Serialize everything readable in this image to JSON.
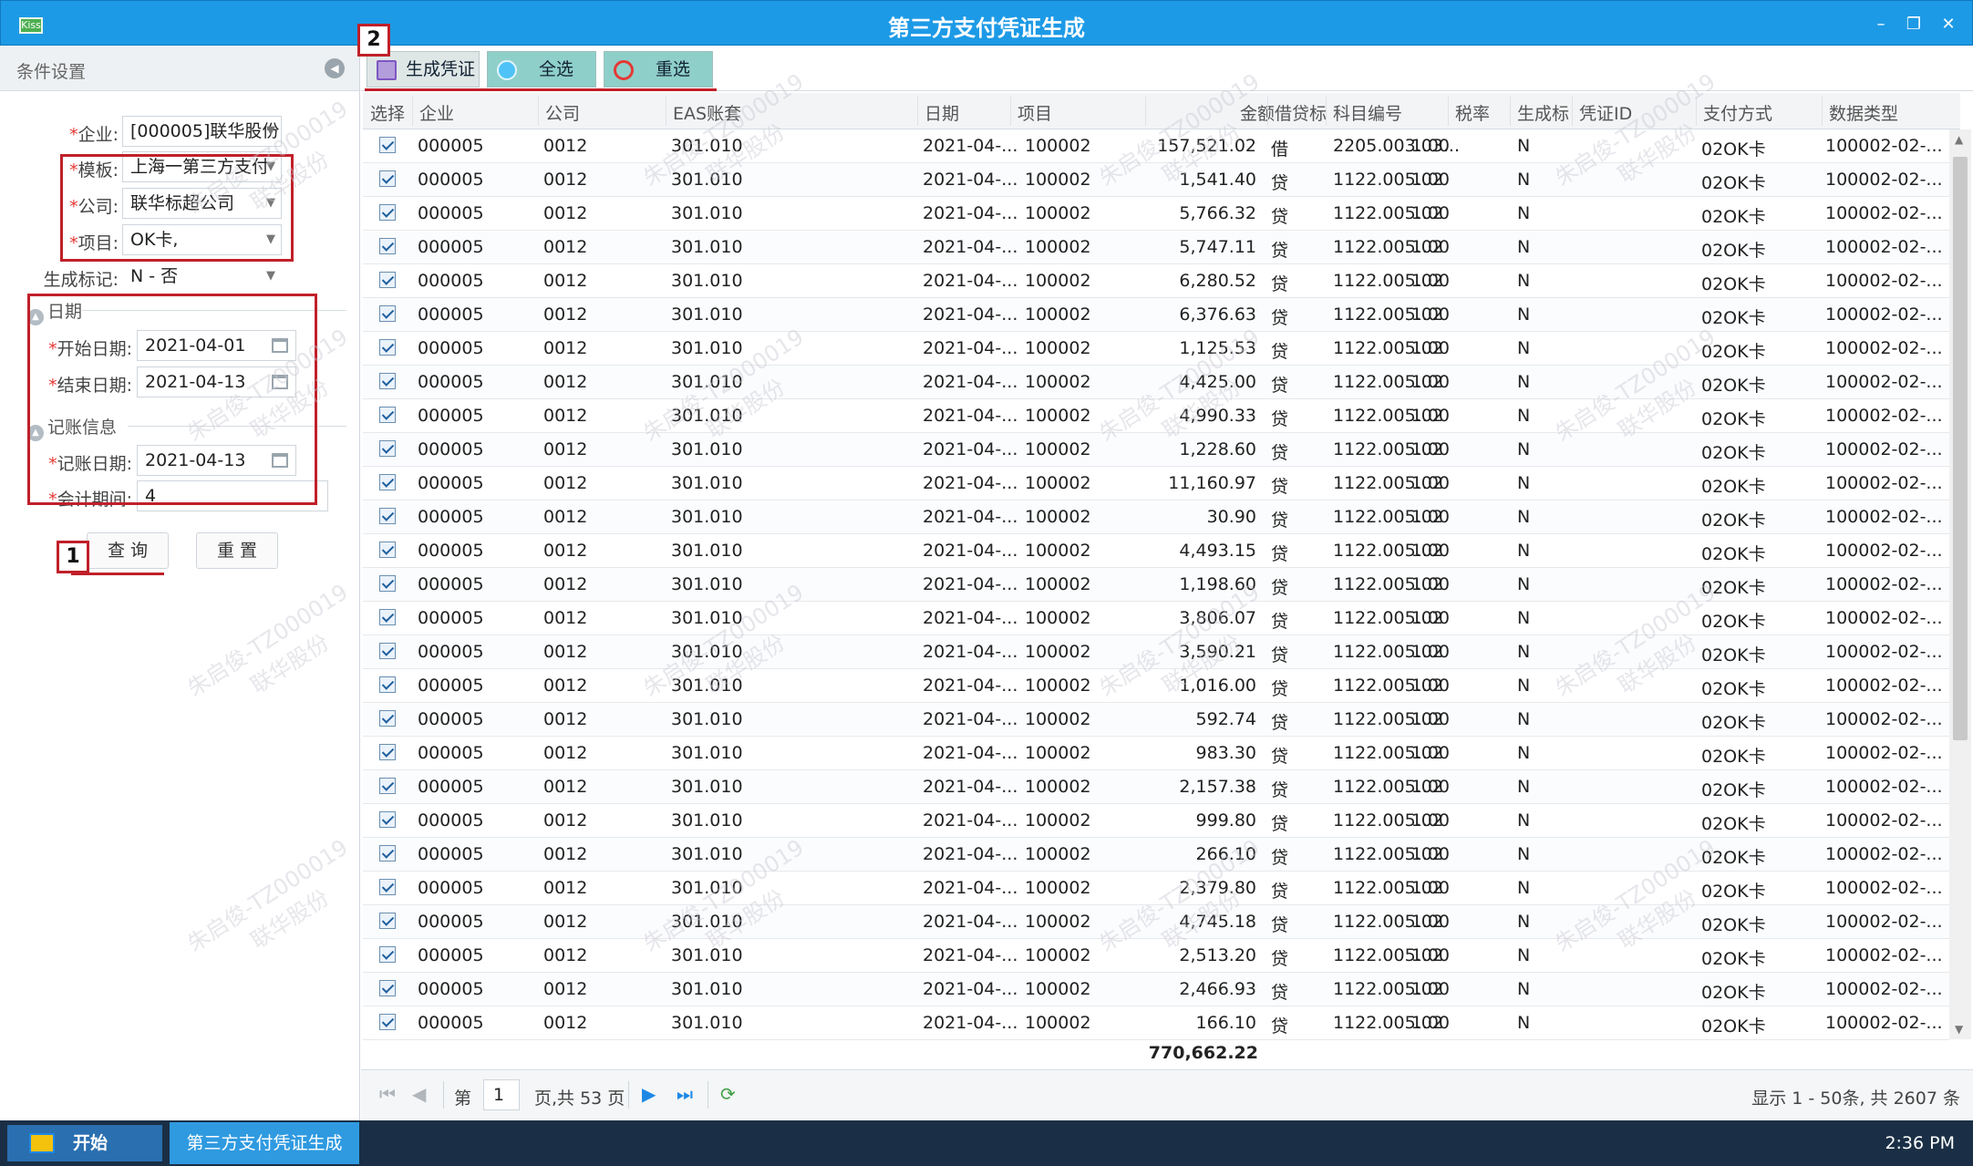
{
  "window": {
    "title": "第三方支付凭证生成",
    "app_icon_text": "Kiss",
    "minimize": "–",
    "restore": "❐",
    "close": "✕"
  },
  "left_panel": {
    "header": "条件设置",
    "fields": {
      "enterprise": {
        "label": "企业:",
        "value": "[000005]联华股份"
      },
      "template": {
        "label": "模板:",
        "value": "上海一第三方支付"
      },
      "company": {
        "label": "公司:",
        "value": "联华标超公司"
      },
      "project": {
        "label": "项目:",
        "value": "OK卡,"
      },
      "gen_flag": {
        "label": "生成标记:",
        "value": "N - 否"
      },
      "start_date": {
        "label": "开始日期:",
        "value": "2021-04-01"
      },
      "end_date": {
        "label": "结束日期:",
        "value": "2021-04-13"
      },
      "post_date": {
        "label": "记账日期:",
        "value": "2021-04-13"
      },
      "period": {
        "label": "会计期间:",
        "value": "4"
      }
    },
    "sections": {
      "date": "日期",
      "posting": "记账信息"
    },
    "query_button": "查 询",
    "reset_button": "重 置",
    "marker_1": "1"
  },
  "toolbar": {
    "generate": "生成凭证",
    "select_all": "全选",
    "reselect": "重选",
    "marker_2": "2"
  },
  "grid": {
    "columns": [
      "选择",
      "企业",
      "公司",
      "EAS账套",
      "日期",
      "项目",
      "金额",
      "借贷标",
      "科目编号",
      "税率",
      "生成标",
      "凭证ID",
      "支付方式",
      "数据类型"
    ],
    "rows": [
      {
        "ent": "000005",
        "co": "0012",
        "eas": "301.010",
        "date": "2021-04-...",
        "proj": "100002",
        "amt": "157,521.02",
        "dc": "借",
        "acct": "2205.003.03...",
        "tax": "1.00",
        "gen": "N",
        "vid": "",
        "pay": "02OK卡",
        "type": "100002-02-..."
      },
      {
        "ent": "000005",
        "co": "0012",
        "eas": "301.010",
        "date": "2021-04-...",
        "proj": "100002",
        "amt": "1,541.40",
        "dc": "贷",
        "acct": "1122.005.02",
        "tax": "1.00",
        "gen": "N",
        "vid": "",
        "pay": "02OK卡",
        "type": "100002-02-..."
      },
      {
        "ent": "000005",
        "co": "0012",
        "eas": "301.010",
        "date": "2021-04-...",
        "proj": "100002",
        "amt": "5,766.32",
        "dc": "贷",
        "acct": "1122.005.02",
        "tax": "1.00",
        "gen": "N",
        "vid": "",
        "pay": "02OK卡",
        "type": "100002-02-..."
      },
      {
        "ent": "000005",
        "co": "0012",
        "eas": "301.010",
        "date": "2021-04-...",
        "proj": "100002",
        "amt": "5,747.11",
        "dc": "贷",
        "acct": "1122.005.02",
        "tax": "1.00",
        "gen": "N",
        "vid": "",
        "pay": "02OK卡",
        "type": "100002-02-..."
      },
      {
        "ent": "000005",
        "co": "0012",
        "eas": "301.010",
        "date": "2021-04-...",
        "proj": "100002",
        "amt": "6,280.52",
        "dc": "贷",
        "acct": "1122.005.02",
        "tax": "1.00",
        "gen": "N",
        "vid": "",
        "pay": "02OK卡",
        "type": "100002-02-..."
      },
      {
        "ent": "000005",
        "co": "0012",
        "eas": "301.010",
        "date": "2021-04-...",
        "proj": "100002",
        "amt": "6,376.63",
        "dc": "贷",
        "acct": "1122.005.02",
        "tax": "1.00",
        "gen": "N",
        "vid": "",
        "pay": "02OK卡",
        "type": "100002-02-..."
      },
      {
        "ent": "000005",
        "co": "0012",
        "eas": "301.010",
        "date": "2021-04-...",
        "proj": "100002",
        "amt": "1,125.53",
        "dc": "贷",
        "acct": "1122.005.02",
        "tax": "1.00",
        "gen": "N",
        "vid": "",
        "pay": "02OK卡",
        "type": "100002-02-..."
      },
      {
        "ent": "000005",
        "co": "0012",
        "eas": "301.010",
        "date": "2021-04-...",
        "proj": "100002",
        "amt": "4,425.00",
        "dc": "贷",
        "acct": "1122.005.02",
        "tax": "1.00",
        "gen": "N",
        "vid": "",
        "pay": "02OK卡",
        "type": "100002-02-..."
      },
      {
        "ent": "000005",
        "co": "0012",
        "eas": "301.010",
        "date": "2021-04-...",
        "proj": "100002",
        "amt": "4,990.33",
        "dc": "贷",
        "acct": "1122.005.02",
        "tax": "1.00",
        "gen": "N",
        "vid": "",
        "pay": "02OK卡",
        "type": "100002-02-..."
      },
      {
        "ent": "000005",
        "co": "0012",
        "eas": "301.010",
        "date": "2021-04-...",
        "proj": "100002",
        "amt": "1,228.60",
        "dc": "贷",
        "acct": "1122.005.02",
        "tax": "1.00",
        "gen": "N",
        "vid": "",
        "pay": "02OK卡",
        "type": "100002-02-..."
      },
      {
        "ent": "000005",
        "co": "0012",
        "eas": "301.010",
        "date": "2021-04-...",
        "proj": "100002",
        "amt": "11,160.97",
        "dc": "贷",
        "acct": "1122.005.02",
        "tax": "1.00",
        "gen": "N",
        "vid": "",
        "pay": "02OK卡",
        "type": "100002-02-..."
      },
      {
        "ent": "000005",
        "co": "0012",
        "eas": "301.010",
        "date": "2021-04-...",
        "proj": "100002",
        "amt": "30.90",
        "dc": "贷",
        "acct": "1122.005.02",
        "tax": "1.00",
        "gen": "N",
        "vid": "",
        "pay": "02OK卡",
        "type": "100002-02-..."
      },
      {
        "ent": "000005",
        "co": "0012",
        "eas": "301.010",
        "date": "2021-04-...",
        "proj": "100002",
        "amt": "4,493.15",
        "dc": "贷",
        "acct": "1122.005.02",
        "tax": "1.00",
        "gen": "N",
        "vid": "",
        "pay": "02OK卡",
        "type": "100002-02-..."
      },
      {
        "ent": "000005",
        "co": "0012",
        "eas": "301.010",
        "date": "2021-04-...",
        "proj": "100002",
        "amt": "1,198.60",
        "dc": "贷",
        "acct": "1122.005.02",
        "tax": "1.00",
        "gen": "N",
        "vid": "",
        "pay": "02OK卡",
        "type": "100002-02-..."
      },
      {
        "ent": "000005",
        "co": "0012",
        "eas": "301.010",
        "date": "2021-04-...",
        "proj": "100002",
        "amt": "3,806.07",
        "dc": "贷",
        "acct": "1122.005.02",
        "tax": "1.00",
        "gen": "N",
        "vid": "",
        "pay": "02OK卡",
        "type": "100002-02-..."
      },
      {
        "ent": "000005",
        "co": "0012",
        "eas": "301.010",
        "date": "2021-04-...",
        "proj": "100002",
        "amt": "3,590.21",
        "dc": "贷",
        "acct": "1122.005.02",
        "tax": "1.00",
        "gen": "N",
        "vid": "",
        "pay": "02OK卡",
        "type": "100002-02-..."
      },
      {
        "ent": "000005",
        "co": "0012",
        "eas": "301.010",
        "date": "2021-04-...",
        "proj": "100002",
        "amt": "1,016.00",
        "dc": "贷",
        "acct": "1122.005.02",
        "tax": "1.00",
        "gen": "N",
        "vid": "",
        "pay": "02OK卡",
        "type": "100002-02-..."
      },
      {
        "ent": "000005",
        "co": "0012",
        "eas": "301.010",
        "date": "2021-04-...",
        "proj": "100002",
        "amt": "592.74",
        "dc": "贷",
        "acct": "1122.005.02",
        "tax": "1.00",
        "gen": "N",
        "vid": "",
        "pay": "02OK卡",
        "type": "100002-02-..."
      },
      {
        "ent": "000005",
        "co": "0012",
        "eas": "301.010",
        "date": "2021-04-...",
        "proj": "100002",
        "amt": "983.30",
        "dc": "贷",
        "acct": "1122.005.02",
        "tax": "1.00",
        "gen": "N",
        "vid": "",
        "pay": "02OK卡",
        "type": "100002-02-..."
      },
      {
        "ent": "000005",
        "co": "0012",
        "eas": "301.010",
        "date": "2021-04-...",
        "proj": "100002",
        "amt": "2,157.38",
        "dc": "贷",
        "acct": "1122.005.02",
        "tax": "1.00",
        "gen": "N",
        "vid": "",
        "pay": "02OK卡",
        "type": "100002-02-..."
      },
      {
        "ent": "000005",
        "co": "0012",
        "eas": "301.010",
        "date": "2021-04-...",
        "proj": "100002",
        "amt": "999.80",
        "dc": "贷",
        "acct": "1122.005.02",
        "tax": "1.00",
        "gen": "N",
        "vid": "",
        "pay": "02OK卡",
        "type": "100002-02-..."
      },
      {
        "ent": "000005",
        "co": "0012",
        "eas": "301.010",
        "date": "2021-04-...",
        "proj": "100002",
        "amt": "266.10",
        "dc": "贷",
        "acct": "1122.005.02",
        "tax": "1.00",
        "gen": "N",
        "vid": "",
        "pay": "02OK卡",
        "type": "100002-02-..."
      },
      {
        "ent": "000005",
        "co": "0012",
        "eas": "301.010",
        "date": "2021-04-...",
        "proj": "100002",
        "amt": "2,379.80",
        "dc": "贷",
        "acct": "1122.005.02",
        "tax": "1.00",
        "gen": "N",
        "vid": "",
        "pay": "02OK卡",
        "type": "100002-02-..."
      },
      {
        "ent": "000005",
        "co": "0012",
        "eas": "301.010",
        "date": "2021-04-...",
        "proj": "100002",
        "amt": "4,745.18",
        "dc": "贷",
        "acct": "1122.005.02",
        "tax": "1.00",
        "gen": "N",
        "vid": "",
        "pay": "02OK卡",
        "type": "100002-02-..."
      },
      {
        "ent": "000005",
        "co": "0012",
        "eas": "301.010",
        "date": "2021-04-...",
        "proj": "100002",
        "amt": "2,513.20",
        "dc": "贷",
        "acct": "1122.005.02",
        "tax": "1.00",
        "gen": "N",
        "vid": "",
        "pay": "02OK卡",
        "type": "100002-02-..."
      },
      {
        "ent": "000005",
        "co": "0012",
        "eas": "301.010",
        "date": "2021-04-...",
        "proj": "100002",
        "amt": "2,466.93",
        "dc": "贷",
        "acct": "1122.005.02",
        "tax": "1.00",
        "gen": "N",
        "vid": "",
        "pay": "02OK卡",
        "type": "100002-02-..."
      },
      {
        "ent": "000005",
        "co": "0012",
        "eas": "301.010",
        "date": "2021-04-...",
        "proj": "100002",
        "amt": "166.10",
        "dc": "贷",
        "acct": "1122.005.02",
        "tax": "1.00",
        "gen": "N",
        "vid": "",
        "pay": "02OK卡",
        "type": "100002-02-..."
      }
    ],
    "total_amount": "770,662.22"
  },
  "pager": {
    "page_prefix": "第",
    "current_page": "1",
    "page_suffix": "页,共 53 页",
    "summary": "显示 1 - 50条, 共 2607 条"
  },
  "taskbar": {
    "start": "开始",
    "task": "第三方支付凭证生成",
    "clock": "2:36 PM"
  },
  "watermark": {
    "line1": "朱启俊-TZ000019",
    "line2": "联华股份"
  },
  "colors": {
    "titlebar": "#1d9ae6",
    "toolbar_button": "#8fcfc9",
    "annotation_red": "#c0202a",
    "taskbar": "#1a2f45"
  }
}
